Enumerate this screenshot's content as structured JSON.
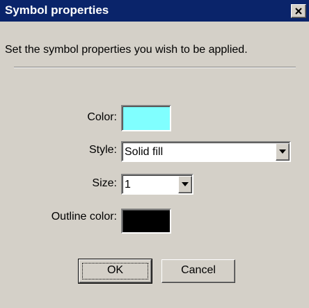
{
  "dialog": {
    "title": "Symbol properties",
    "close_icon": "close-x-icon",
    "instruction": "Set the symbol properties you wish to be applied."
  },
  "fields": {
    "color": {
      "label": "Color:",
      "value_color": "#80ffff"
    },
    "style": {
      "label": "Style:",
      "value": "Solid fill"
    },
    "size": {
      "label": "Size:",
      "value": "1"
    },
    "outline_color": {
      "label": "Outline color:",
      "value_color": "#000000"
    }
  },
  "buttons": {
    "ok_label": "OK",
    "cancel_label": "Cancel"
  },
  "colors": {
    "titlebar": "#0a246a",
    "face": "#d4d0c8"
  }
}
